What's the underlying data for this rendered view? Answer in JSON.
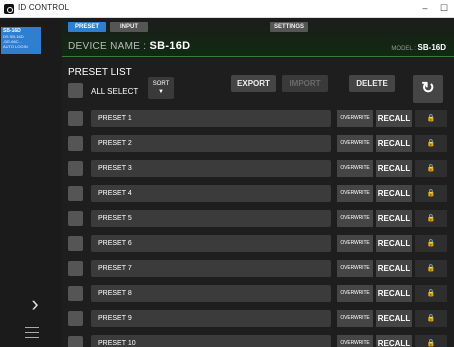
{
  "app": {
    "title": "ID CONTROL"
  },
  "window_controls": {
    "minimize": "–",
    "maximize": "☐"
  },
  "sidebar": {
    "device": {
      "name": "SB-16D",
      "line1": "DS SB-16D",
      "line2": "-DE-66C...",
      "line3": "AUTO LOGIN"
    },
    "chevron": "›"
  },
  "header": {
    "tabs": {
      "preset": "PRESET",
      "input": "INPUT",
      "settings": "SETTINGS"
    },
    "device_name_label": "DEVICE NAME :",
    "device_name_value": "SB-16D",
    "model_label": "MODEL :",
    "model_value": "SB-16D"
  },
  "main": {
    "title": "PRESET LIST",
    "select_all_label": "ALL SELECT",
    "sort": {
      "label": "SORT",
      "arrow": "▼"
    },
    "buttons": {
      "export": "EXPORT",
      "import": "IMPORT",
      "delete": "DELETE",
      "refresh": "↻"
    },
    "overwrite_label": "OVERWRITE",
    "recall_label": "RECALL",
    "lock_glyph": "🔒",
    "presets": [
      {
        "name": "PRESET 1"
      },
      {
        "name": "PRESET 2"
      },
      {
        "name": "PRESET 3"
      },
      {
        "name": "PRESET 4"
      },
      {
        "name": "PRESET 5"
      },
      {
        "name": "PRESET 6"
      },
      {
        "name": "PRESET 7"
      },
      {
        "name": "PRESET 8"
      },
      {
        "name": "PRESET 9"
      },
      {
        "name": "PRESET 10"
      }
    ]
  },
  "colors": {
    "accent": "#2f7fd1",
    "background": "#1e1e1e",
    "header_gradient_end": "#0f2a10",
    "button_bg": "#454545",
    "row_bg": "#3b3b3b"
  }
}
